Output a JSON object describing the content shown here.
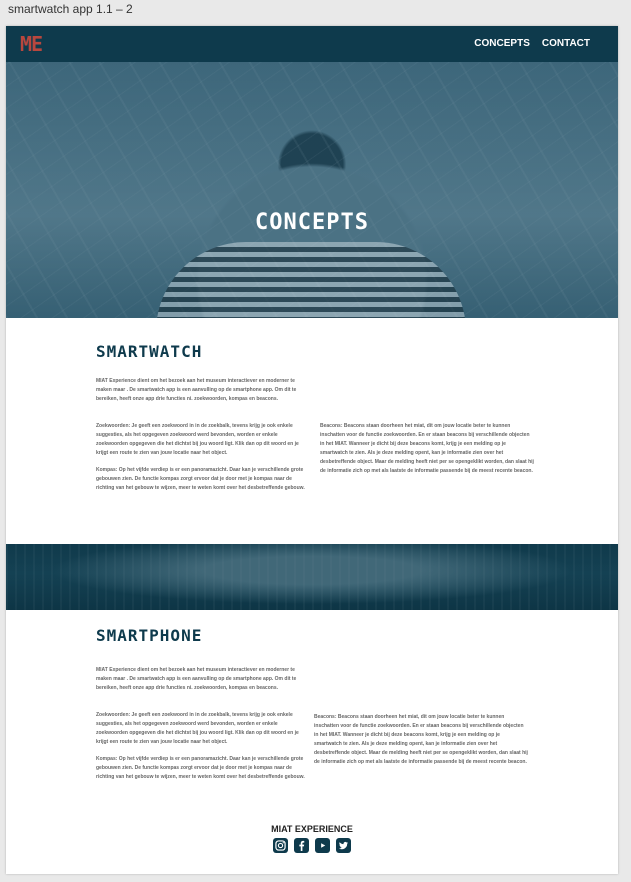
{
  "window": {
    "title": "smartwatch app 1.1 – 2"
  },
  "header": {
    "logo": "ME",
    "nav": [
      "CONCEPTS",
      "CONTACT"
    ]
  },
  "hero": {
    "title": "CONCEPTS"
  },
  "smartwatch": {
    "title": "SMARTWATCH",
    "intro": "MIAT Experience dient om het bezoek aan het museum interactiever en moderner te maken maar . De smartwatch app is een aanvulling op de smartphone app. Om dit te bereiken, heeft onze app drie functies ni. zoekwoorden, kompas en beacons.",
    "zoekwoorden": "Zoekwoorden: Je geeft een zoekwoord in in de zoekbalk, tevens krijg je ook enkele suggesties, als het opgegeven zoekwoord werd bevonden, worden er enkele zoekwoorden opgegeven die het dichtst bij jou woord ligt. Klik dan op dit woord en je krijgt een route te zien van jouw locatie naar het object.",
    "kompas": "Kompas: Op het vijfde verdiep is er een panoramazicht. Daar kan je verschillende grote gebouwen zien. De functie kompas zorgt ervoor dat je door met je kompas naar de richting van het gebouw te wijzen, meer te weten komt over het desbetreffende gebouw.",
    "beacons": "Beacons: Beacons staan doorheen het miat, dit om jouw locatie beter te kunnen inschatten voor de functie zoekwoorden. En er staan beacons bij verschillende objecten in het MIAT. Wanneer je dicht bij deze beacons komt, krijg je een melding op je smartwatch te zien. Als je deze melding opent, kan je informatie zien over het desbetreffende object. Maar de melding heeft niet per se opengeklikt worden, dan slaat hij de informatie zich op met als laatste de informatie passende bij de meest recente beacon."
  },
  "smartphone": {
    "title": "SMARTPHONE",
    "intro": "MIAT Experience dient om het bezoek aan het museum interactiever en moderner te maken maar . De smartwatch app is een aanvulling op de smartphone app. Om dit te bereiken, heeft onze app drie functies ni. zoekwoorden, kompas en beacons.",
    "zoekwoorden": "Zoekwoorden: Je geeft een zoekwoord in in de zoekbalk, tevens krijg je ook enkele suggesties, als het opgegeven zoekwoord werd bevonden, worden er enkele zoekwoorden opgegeven die het dichtst bij jou woord ligt. Klik dan op dit woord en je krijgt een route te zien van jouw locatie naar het object.",
    "kompas": "Kompas: Op het vijfde verdiep is er een panoramazicht. Daar kan je verschillende grote gebouwen zien. De functie kompas zorgt ervoor dat je door met je kompas naar de richting van het gebouw te wijzen, meer te weten komt over het desbetreffende gebouw.",
    "beacons": "Beacons: Beacons staan doorheen het miat, dit om jouw locatie beter te kunnen inschatten voor de functie zoekwoorden. En er staan beacons bij verschillende objecten in het MIAT. Wanneer je dicht bij deze beacons komt, krijg je een melding op je smartwatch te zien. Als je deze melding opent, kan je informatie zien over het desbetreffende object. Maar de melding heeft niet per se opengeklikt worden, dan slaat hij de informatie zich op met als laatste de informatie passende bij de meest recente beacon."
  },
  "footer": {
    "title": "MIAT EXPERIENCE",
    "icons": [
      "instagram-icon",
      "facebook-icon",
      "youtube-icon",
      "twitter-icon"
    ]
  },
  "colors": {
    "primary": "#0e3a4c",
    "logo": "#b8473e"
  }
}
